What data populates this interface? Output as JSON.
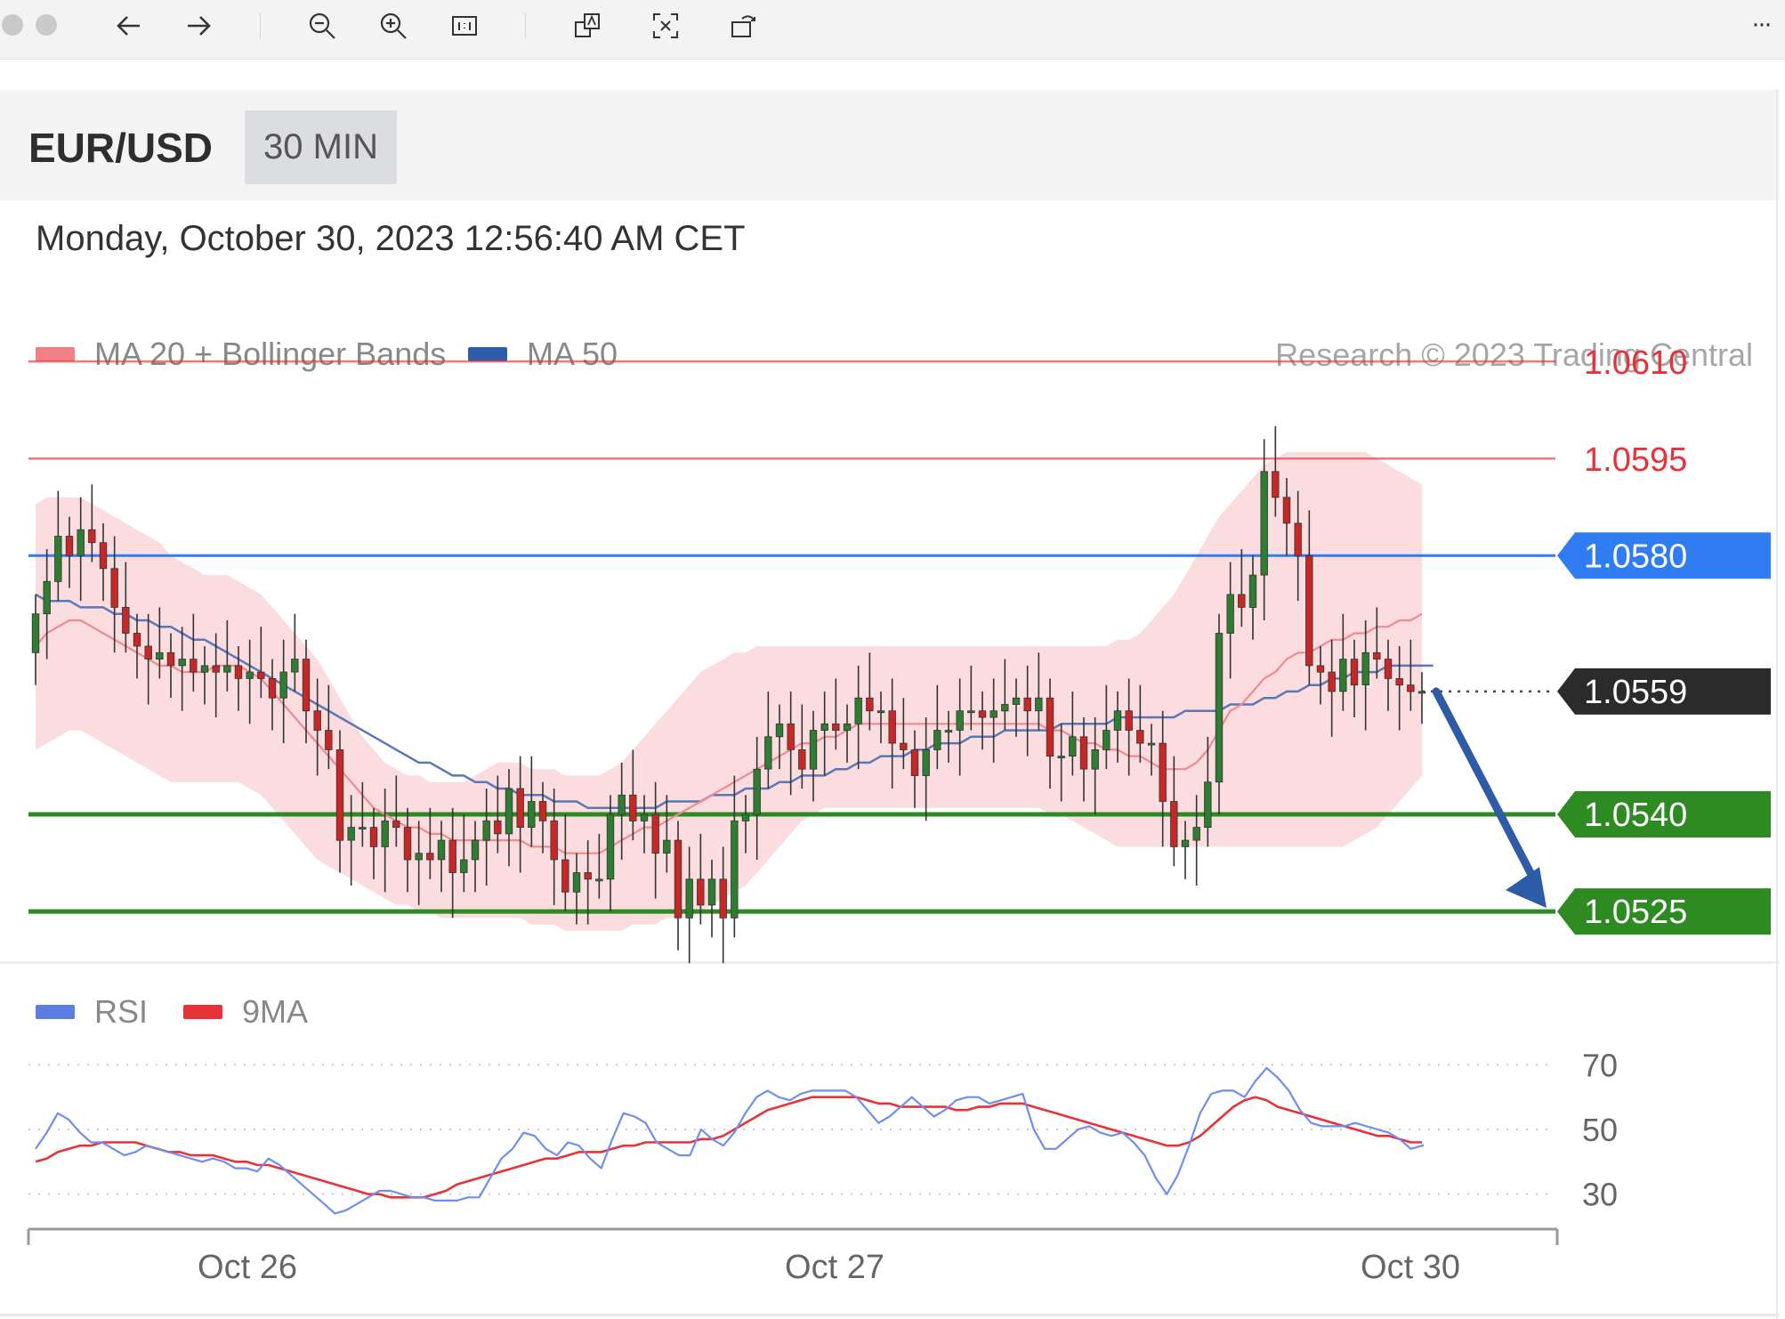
{
  "toolbar": {
    "icons": [
      "close-icon",
      "stop-icon",
      "back-arrow-icon",
      "forward-arrow-icon",
      "zoom-out-icon",
      "zoom-in-icon",
      "actual-size-icon",
      "translate-icon",
      "crop-icon",
      "rotate-icon",
      "more-icon"
    ],
    "more_label": "···"
  },
  "header": {
    "pair": "EUR/USD",
    "timeframe": "30 MIN"
  },
  "datetime": "Monday, October 30, 2023 12:56:40 AM CET",
  "legend_main": [
    {
      "label": "MA 20 + Bollinger Bands",
      "color": "#f07f86"
    },
    {
      "label": "MA 50",
      "color": "#2f5ea8"
    }
  ],
  "credit": "Research © 2023 Trading Central",
  "legend_rsi": [
    {
      "label": "RSI",
      "color": "#5b7fe0"
    },
    {
      "label": "9MA",
      "color": "#e8323a"
    }
  ],
  "chart_data": {
    "type": "candlestick",
    "title": "EUR/USD",
    "timeframe": "30 MIN",
    "ylim": [
      1.0518,
      1.0618
    ],
    "x_ticks": [
      "Oct 26",
      "Oct 27",
      "Oct 30"
    ],
    "levels": [
      {
        "value": 1.061,
        "label": "1.0610",
        "type": "resistance",
        "color": "#e8313a"
      },
      {
        "value": 1.0595,
        "label": "1.0595",
        "type": "resistance",
        "color": "#e8313a"
      },
      {
        "value": 1.058,
        "label": "1.0580",
        "type": "pivot",
        "color": "#2f7cf3"
      },
      {
        "value": 1.0559,
        "label": "1.0559",
        "type": "last-price",
        "color": "#2b2b2b"
      },
      {
        "value": 1.054,
        "label": "1.0540",
        "type": "support",
        "color": "#2e8b22"
      },
      {
        "value": 1.0525,
        "label": "1.0525",
        "type": "support",
        "color": "#2e8b22"
      }
    ],
    "forecast_arrow": {
      "from": 1.0559,
      "to": 1.0525,
      "color": "#2e5ba6"
    },
    "close": [
      1.0571,
      1.0576,
      1.0583,
      1.058,
      1.0584,
      1.0582,
      1.0578,
      1.0572,
      1.0568,
      1.0566,
      1.0564,
      1.0565,
      1.0563,
      1.0564,
      1.0562,
      1.0563,
      1.0562,
      1.0563,
      1.0561,
      1.0562,
      1.0561,
      1.0558,
      1.0562,
      1.0564,
      1.0556,
      1.0553,
      1.055,
      1.0536,
      1.0538,
      1.0538,
      1.0535,
      1.0539,
      1.0538,
      1.0533,
      1.0534,
      1.0533,
      1.0536,
      1.0531,
      1.0533,
      1.0536,
      1.0539,
      1.0537,
      1.0544,
      1.0538,
      1.0542,
      1.0539,
      1.0533,
      1.0528,
      1.0531,
      1.053,
      1.053,
      1.054,
      1.0543,
      1.0539,
      1.054,
      1.0534,
      1.0536,
      1.0524,
      1.053,
      1.0526,
      1.053,
      1.0524,
      1.0539,
      1.054,
      1.0547,
      1.0552,
      1.0554,
      1.055,
      1.0547,
      1.0553,
      1.0554,
      1.0553,
      1.0554,
      1.0558,
      1.0556,
      1.0556,
      1.0551,
      1.055,
      1.0546,
      1.055,
      1.0553,
      1.0553,
      1.0556,
      1.0556,
      1.0555,
      1.0556,
      1.0557,
      1.0558,
      1.0556,
      1.0558,
      1.0549,
      1.0549,
      1.0552,
      1.0547,
      1.055,
      1.0553,
      1.0556,
      1.0553,
      1.0551,
      1.0551,
      1.0542,
      1.0535,
      1.0536,
      1.0538,
      1.0545,
      1.0568,
      1.0574,
      1.0572,
      1.0577,
      1.0593,
      1.0589,
      1.0585,
      1.058,
      1.0563,
      1.0562,
      1.0559,
      1.0564,
      1.056,
      1.0565,
      1.0564,
      1.0561,
      1.056,
      1.0559,
      1.0559
    ],
    "ma20": [
      1.0566,
      1.0568,
      1.0569,
      1.057,
      1.057,
      1.0569,
      1.0568,
      1.0567,
      1.0566,
      1.0565,
      1.0564,
      1.0563,
      1.0563,
      1.0562,
      1.0562,
      1.0562,
      1.0563,
      1.0563,
      1.0563,
      1.0562,
      1.0561,
      1.0559,
      1.0557,
      1.0555,
      1.0553,
      1.0551,
      1.0549,
      1.0547,
      1.0545,
      1.0543,
      1.0541,
      1.054,
      1.0539,
      1.0538,
      1.0538,
      1.0537,
      1.0537,
      1.0536,
      1.0536,
      1.0536,
      1.0536,
      1.0536,
      1.0536,
      1.0536,
      1.0535,
      1.0535,
      1.0535,
      1.0534,
      1.0534,
      1.0534,
      1.0534,
      1.0535,
      1.0536,
      1.0537,
      1.0538,
      1.0538,
      1.0539,
      1.054,
      1.0541,
      1.0542,
      1.0543,
      1.0544,
      1.0545,
      1.0546,
      1.0547,
      1.0548,
      1.0549,
      1.055,
      1.0551,
      1.0551,
      1.0552,
      1.0552,
      1.0553,
      1.0554,
      1.0554,
      1.0554,
      1.0554,
      1.0554,
      1.0554,
      1.0554,
      1.0554,
      1.0554,
      1.0554,
      1.0554,
      1.0554,
      1.0554,
      1.0554,
      1.0554,
      1.0554,
      1.0554,
      1.0553,
      1.0553,
      1.0552,
      1.0551,
      1.0551,
      1.055,
      1.055,
      1.0549,
      1.0549,
      1.0548,
      1.0547,
      1.0547,
      1.0547,
      1.0548,
      1.055,
      1.0553,
      1.0556,
      1.0557,
      1.0559,
      1.0561,
      1.0562,
      1.0564,
      1.0565,
      1.0565,
      1.0566,
      1.0567,
      1.0567,
      1.0568,
      1.0568,
      1.0569,
      1.0569,
      1.057,
      1.057,
      1.0571
    ],
    "ma50": [
      1.0574,
      1.0573,
      1.0573,
      1.0573,
      1.0572,
      1.0572,
      1.0572,
      1.0571,
      1.0571,
      1.057,
      1.057,
      1.0569,
      1.0569,
      1.0568,
      1.0567,
      1.0567,
      1.0566,
      1.0565,
      1.0564,
      1.0563,
      1.0562,
      1.0561,
      1.056,
      1.0559,
      1.0558,
      1.0557,
      1.0556,
      1.0555,
      1.0554,
      1.0553,
      1.0552,
      1.0551,
      1.055,
      1.0549,
      1.0548,
      1.0548,
      1.0547,
      1.0546,
      1.0546,
      1.0545,
      1.0545,
      1.0544,
      1.0544,
      1.0543,
      1.0543,
      1.0543,
      1.0542,
      1.0542,
      1.0542,
      1.0541,
      1.0541,
      1.0541,
      1.0541,
      1.0541,
      1.0541,
      1.0541,
      1.0542,
      1.0542,
      1.0542,
      1.0542,
      1.0543,
      1.0543,
      1.0543,
      1.0544,
      1.0544,
      1.0544,
      1.0545,
      1.0545,
      1.0546,
      1.0546,
      1.0546,
      1.0547,
      1.0547,
      1.0548,
      1.0548,
      1.0549,
      1.0549,
      1.0549,
      1.055,
      1.055,
      1.0551,
      1.0551,
      1.0551,
      1.0552,
      1.0552,
      1.0552,
      1.0553,
      1.0553,
      1.0553,
      1.0553,
      1.0553,
      1.0554,
      1.0554,
      1.0554,
      1.0554,
      1.0554,
      1.0555,
      1.0555,
      1.0555,
      1.0555,
      1.0555,
      1.0555,
      1.0556,
      1.0556,
      1.0556,
      1.0556,
      1.0557,
      1.0557,
      1.0557,
      1.0558,
      1.0558,
      1.0559,
      1.0559,
      1.056,
      1.056,
      1.0561,
      1.0561,
      1.0562,
      1.0562,
      1.0562,
      1.0563,
      1.0563,
      1.0563,
      1.0563,
      1.0563
    ],
    "bb_upper": [
      1.0588,
      1.0589,
      1.0589,
      1.0589,
      1.0589,
      1.0588,
      1.0587,
      1.0586,
      1.0585,
      1.0584,
      1.0583,
      1.0582,
      1.058,
      1.0579,
      1.0578,
      1.0577,
      1.0577,
      1.0577,
      1.0576,
      1.0575,
      1.0574,
      1.0572,
      1.057,
      1.0568,
      1.0566,
      1.0564,
      1.0561,
      1.0558,
      1.0555,
      1.0552,
      1.055,
      1.0548,
      1.0547,
      1.0546,
      1.0546,
      1.0545,
      1.0545,
      1.0545,
      1.0545,
      1.0546,
      1.0547,
      1.0548,
      1.0548,
      1.0548,
      1.0547,
      1.0547,
      1.0547,
      1.0546,
      1.0546,
      1.0546,
      1.0546,
      1.0547,
      1.0548,
      1.055,
      1.0552,
      1.0554,
      1.0556,
      1.0558,
      1.056,
      1.0562,
      1.0563,
      1.0564,
      1.0565,
      1.0565,
      1.0566,
      1.0566,
      1.0566,
      1.0566,
      1.0566,
      1.0566,
      1.0566,
      1.0566,
      1.0566,
      1.0566,
      1.0566,
      1.0566,
      1.0566,
      1.0566,
      1.0566,
      1.0566,
      1.0566,
      1.0566,
      1.0566,
      1.0566,
      1.0566,
      1.0566,
      1.0566,
      1.0566,
      1.0566,
      1.0566,
      1.0566,
      1.0566,
      1.0566,
      1.0566,
      1.0566,
      1.0566,
      1.0567,
      1.0567,
      1.0568,
      1.057,
      1.0572,
      1.0574,
      1.0577,
      1.058,
      1.0583,
      1.0586,
      1.0588,
      1.059,
      1.0592,
      1.0594,
      1.0595,
      1.0596,
      1.0596,
      1.0596,
      1.0596,
      1.0596,
      1.0596,
      1.0596,
      1.0596,
      1.0595,
      1.0594,
      1.0593,
      1.0592,
      1.0591
    ],
    "bb_lower": [
      1.055,
      1.0551,
      1.0552,
      1.0553,
      1.0553,
      1.0552,
      1.0551,
      1.055,
      1.0549,
      1.0548,
      1.0547,
      1.0546,
      1.0545,
      1.0545,
      1.0545,
      1.0545,
      1.0545,
      1.0545,
      1.0545,
      1.0544,
      1.0543,
      1.0541,
      1.0539,
      1.0537,
      1.0535,
      1.0533,
      1.0532,
      1.0531,
      1.053,
      1.0529,
      1.0528,
      1.0527,
      1.0526,
      1.0526,
      1.0525,
      1.0525,
      1.0524,
      1.0524,
      1.0524,
      1.0524,
      1.0524,
      1.0524,
      1.0524,
      1.0524,
      1.0523,
      1.0523,
      1.0523,
      1.0522,
      1.0522,
      1.0522,
      1.0522,
      1.0522,
      1.0522,
      1.0523,
      1.0523,
      1.0523,
      1.0524,
      1.0524,
      1.0524,
      1.0525,
      1.0526,
      1.0527,
      1.0528,
      1.0529,
      1.0531,
      1.0533,
      1.0535,
      1.0537,
      1.0539,
      1.054,
      1.0541,
      1.0541,
      1.0541,
      1.0541,
      1.0541,
      1.0541,
      1.0541,
      1.0541,
      1.0541,
      1.0541,
      1.0541,
      1.0541,
      1.0541,
      1.0541,
      1.0541,
      1.0541,
      1.0541,
      1.0541,
      1.0541,
      1.0541,
      1.054,
      1.054,
      1.0539,
      1.0538,
      1.0537,
      1.0536,
      1.0535,
      1.0535,
      1.0535,
      1.0535,
      1.0535,
      1.0535,
      1.0535,
      1.0535,
      1.0535,
      1.0535,
      1.0535,
      1.0535,
      1.0535,
      1.0535,
      1.0535,
      1.0535,
      1.0535,
      1.0535,
      1.0535,
      1.0535,
      1.0535,
      1.0536,
      1.0537,
      1.0538,
      1.054,
      1.0542,
      1.0544,
      1.0546
    ],
    "rsi": {
      "ylim": [
        20,
        80
      ],
      "levels": [
        70,
        50,
        30
      ],
      "rsi": [
        44,
        49,
        55,
        53,
        49,
        46,
        46,
        44,
        42,
        43,
        45,
        44,
        43,
        42,
        41,
        40,
        41,
        40,
        38,
        38,
        37,
        41,
        39,
        36,
        33,
        30,
        27,
        24,
        25,
        27,
        29,
        31,
        31,
        30,
        29,
        29,
        28,
        28,
        28,
        29,
        29,
        35,
        41,
        44,
        49,
        48,
        44,
        42,
        46,
        45,
        41,
        38,
        47,
        55,
        54,
        52,
        46,
        44,
        42,
        42,
        50,
        47,
        45,
        49,
        55,
        60,
        62,
        60,
        59,
        61,
        62,
        62,
        62,
        62,
        60,
        56,
        52,
        54,
        57,
        60,
        57,
        54,
        56,
        59,
        60,
        60,
        58,
        59,
        60,
        61,
        50,
        44,
        44,
        47,
        50,
        51,
        49,
        48,
        49,
        46,
        42,
        35,
        30,
        36,
        45,
        55,
        61,
        62,
        62,
        60,
        65,
        69,
        66,
        62,
        56,
        52,
        51,
        51,
        51,
        52,
        51,
        50,
        49,
        47,
        44,
        45
      ],
      "ma9": [
        40,
        41,
        43,
        44,
        45,
        45,
        46,
        46,
        46,
        46,
        45,
        44,
        43,
        43,
        42,
        42,
        42,
        41,
        40,
        40,
        39,
        39,
        38,
        37,
        36,
        35,
        34,
        33,
        32,
        31,
        30,
        30,
        29,
        29,
        29,
        29,
        30,
        31,
        33,
        34,
        35,
        36,
        37,
        38,
        39,
        40,
        41,
        41,
        42,
        43,
        43,
        43,
        44,
        45,
        45,
        46,
        46,
        46,
        46,
        46,
        47,
        47,
        48,
        50,
        52,
        54,
        56,
        57,
        58,
        59,
        60,
        60,
        60,
        60,
        60,
        59,
        58,
        58,
        57,
        57,
        57,
        57,
        57,
        56,
        56,
        57,
        57,
        58,
        58,
        58,
        57,
        56,
        55,
        54,
        53,
        52,
        51,
        50,
        49,
        48,
        47,
        46,
        45,
        45,
        46,
        48,
        51,
        54,
        57,
        59,
        60,
        59,
        57,
        56,
        55,
        54,
        53,
        52,
        51,
        50,
        49,
        48,
        48,
        47,
        46,
        46
      ]
    }
  }
}
